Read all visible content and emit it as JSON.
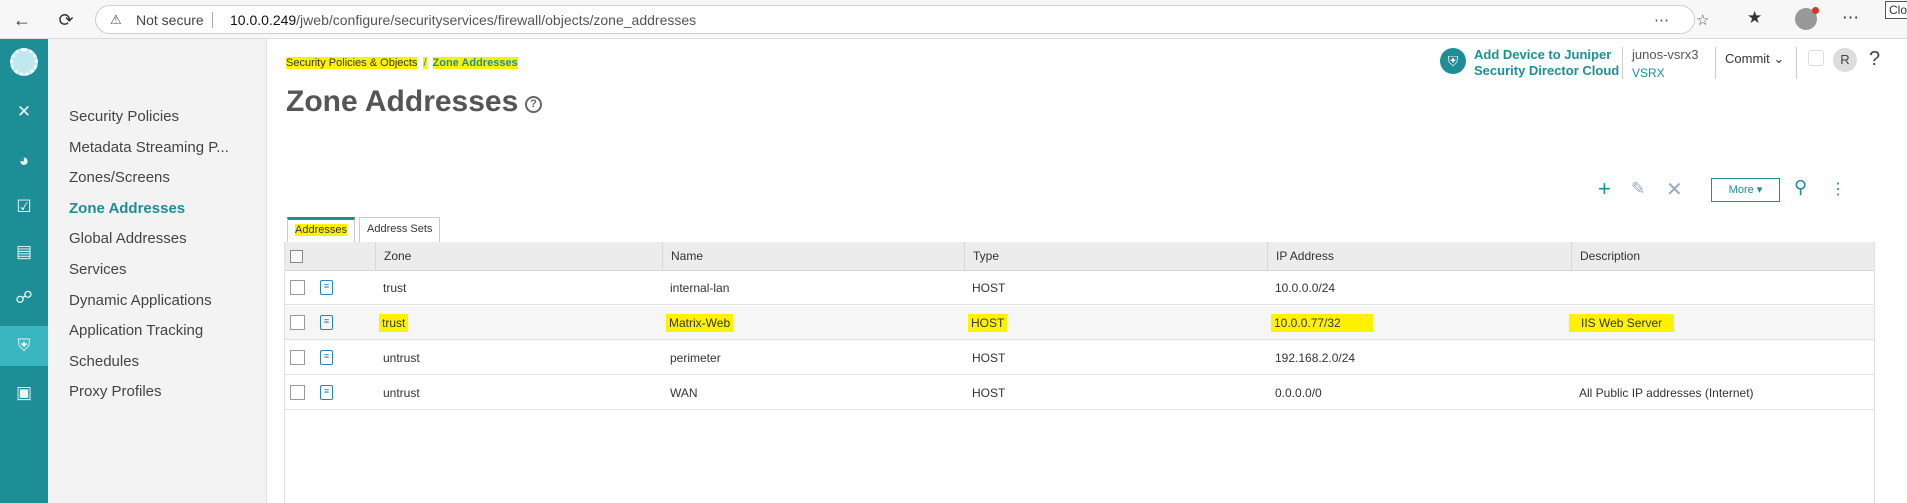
{
  "browser": {
    "not_secure": "Not secure",
    "url_host": "10.0.0.249",
    "url_path": "/jweb/configure/securityservices/firewall/objects/zone_addresses",
    "tooltip": "Close"
  },
  "sidebar": {
    "items": [
      {
        "label": "Security Policies"
      },
      {
        "label": "Metadata Streaming P..."
      },
      {
        "label": "Zones/Screens"
      },
      {
        "label": "Zone Addresses"
      },
      {
        "label": "Global Addresses"
      },
      {
        "label": "Services"
      },
      {
        "label": "Dynamic Applications"
      },
      {
        "label": "Application Tracking"
      },
      {
        "label": "Schedules"
      },
      {
        "label": "Proxy Profiles"
      }
    ]
  },
  "breadcrumb": {
    "parent": "Security Policies & Objects",
    "separator": "/",
    "current": "Zone Addresses"
  },
  "page": {
    "title": "Zone Addresses",
    "help": "?"
  },
  "header": {
    "sdc_line1": "Add Device to Juniper",
    "sdc_line2": "Security Director Cloud",
    "device_name": "junos-vsrx3",
    "device_type": "VSRX",
    "commit_label": "Commit",
    "user_initial": "R",
    "help": "?"
  },
  "toolbar": {
    "more_label": "More"
  },
  "tabs": [
    {
      "label": "Addresses"
    },
    {
      "label": "Address Sets"
    }
  ],
  "table": {
    "columns": [
      "Zone",
      "Name",
      "Type",
      "IP Address",
      "Description"
    ],
    "rows": [
      {
        "zone": "trust",
        "name": "internal-lan",
        "type": "HOST",
        "ip": "10.0.0.0/24",
        "description": ""
      },
      {
        "zone": "trust",
        "name": "Matrix-Web",
        "type": "HOST",
        "ip": "10.0.0.77/32",
        "description": "IIS Web Server"
      },
      {
        "zone": "untrust",
        "name": "perimeter",
        "type": "HOST",
        "ip": "192.168.2.0/24",
        "description": ""
      },
      {
        "zone": "untrust",
        "name": "WAN",
        "type": "HOST",
        "ip": "0.0.0.0/0",
        "description": "All Public IP addresses (Internet)"
      }
    ]
  },
  "colors": {
    "accent": "#1d8e96",
    "highlight": "#fff200"
  }
}
